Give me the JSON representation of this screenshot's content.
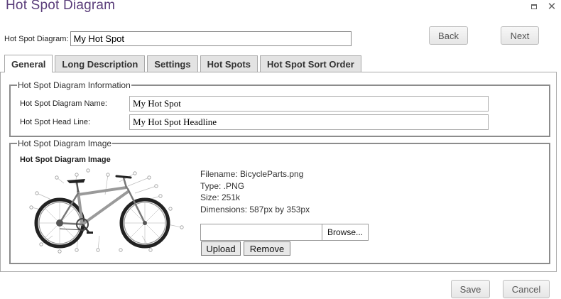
{
  "window": {
    "title": "Hot Spot Diagram"
  },
  "header": {
    "name_label": "Hot Spot Diagram:",
    "name_value": "My Hot Spot",
    "back_label": "Back",
    "next_label": "Next"
  },
  "tabs": [
    {
      "label": "General",
      "active": true
    },
    {
      "label": "Long Description",
      "active": false
    },
    {
      "label": "Settings",
      "active": false
    },
    {
      "label": "Hot Spots",
      "active": false
    },
    {
      "label": "Hot Spot Sort Order",
      "active": false
    }
  ],
  "info_group": {
    "legend": "Hot Spot Diagram Information",
    "name_label": "Hot Spot Diagram Name:",
    "name_value": "My Hot Spot",
    "headline_label": "Hot Spot Head Line:",
    "headline_value": "My Hot Spot Headline"
  },
  "image_group": {
    "legend": "Hot Spot Diagram Image",
    "heading": "Hot Spot Diagram Image",
    "image_icon": "bicycle-parts-diagram",
    "filename": "Filename: BicycleParts.png",
    "type": "Type: .PNG",
    "size": "Size: 251k",
    "dimensions": "Dimensions: 587px by 353px",
    "browse_label": "Browse...",
    "upload_label": "Upload",
    "remove_label": "Remove"
  },
  "footer": {
    "save_label": "Save",
    "cancel_label": "Cancel"
  },
  "colors": {
    "title": "#5a3d7a",
    "border": "#8c8c8c"
  }
}
